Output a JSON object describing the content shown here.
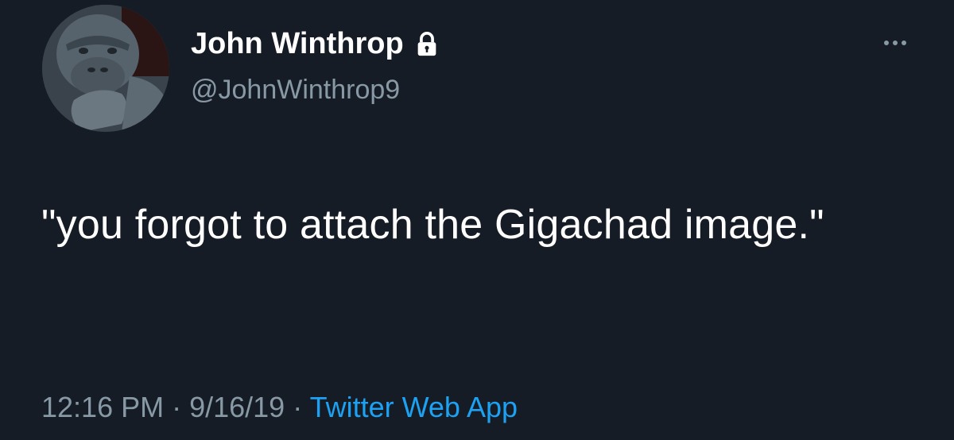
{
  "tweet": {
    "author": {
      "display_name": "John Winthrop",
      "handle": "@JohnWinthrop9",
      "protected": true,
      "avatar_icon": "gorilla-avatar"
    },
    "text": "\"you forgot to attach the Gigachad image.\"",
    "meta": {
      "time": "12:16 PM",
      "separator_1": " · ",
      "date": "9/16/19",
      "separator_2": " · ",
      "source": "Twitter Web App"
    },
    "more_icon": "more-horizontal-icon"
  },
  "colors": {
    "background": "#151c25",
    "primary_text": "#ffffff",
    "secondary_text": "#8899a6",
    "link": "#1da1f2"
  }
}
